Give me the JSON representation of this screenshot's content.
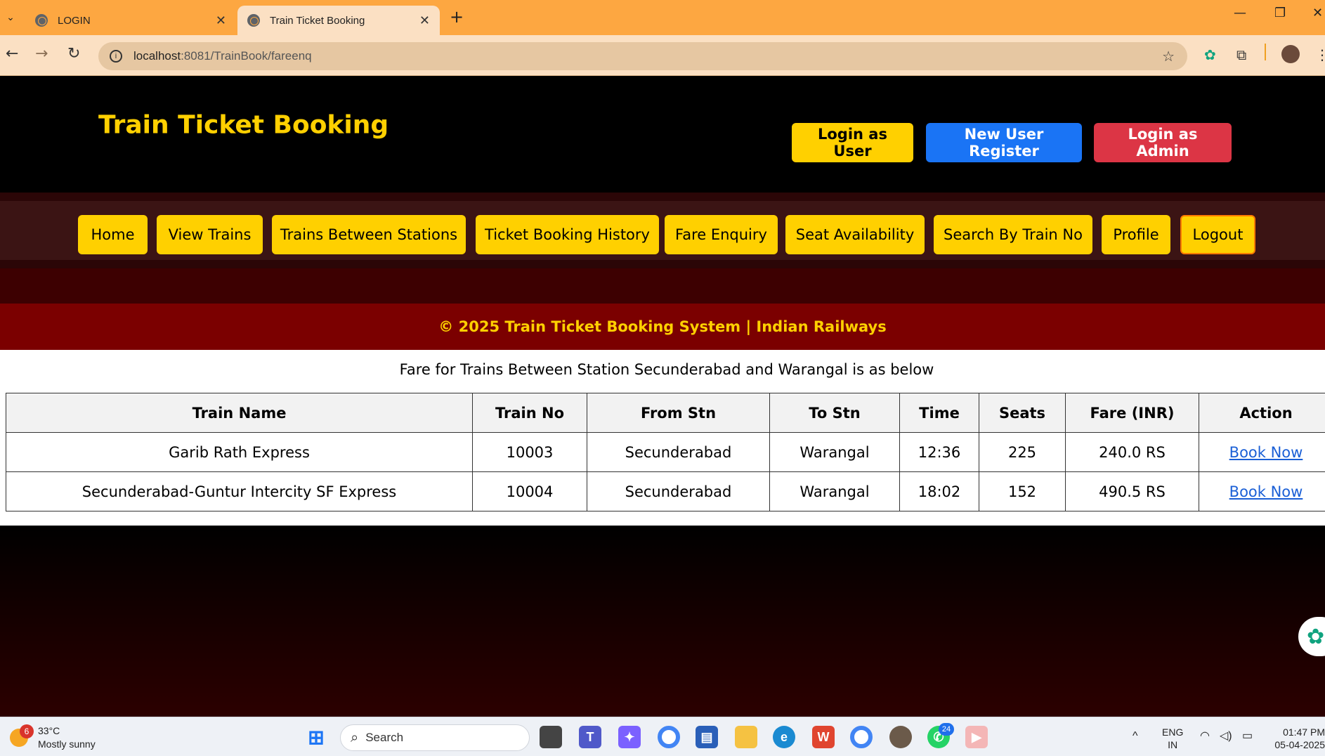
{
  "browser": {
    "tabs": [
      {
        "title": "LOGIN"
      },
      {
        "title": "Train Ticket Booking"
      }
    ],
    "url_host": "localhost",
    "url_path": ":8081/TrainBook/fareenq"
  },
  "header": {
    "site_title": "Train Ticket Booking",
    "buttons": {
      "login_user": "Login as User",
      "register": "New User Register",
      "login_admin": "Login as Admin"
    }
  },
  "nav": {
    "items": [
      {
        "label": "Home"
      },
      {
        "label": "View Trains"
      },
      {
        "label": "Trains Between Stations"
      },
      {
        "label": "Ticket Booking History"
      },
      {
        "label": "Fare Enquiry"
      },
      {
        "label": "Seat Availability"
      },
      {
        "label": "Search By Train No"
      },
      {
        "label": "Profile"
      },
      {
        "label": "Logout"
      }
    ]
  },
  "footer": {
    "text": "© 2025 Train Ticket Booking System | Indian Railways"
  },
  "fare": {
    "caption": "Fare for Trains Between Station Secunderabad and Warangal is as below",
    "columns": [
      "Train Name",
      "Train No",
      "From Stn",
      "To Stn",
      "Time",
      "Seats",
      "Fare (INR)",
      "Action"
    ],
    "rows": [
      [
        "Garib Rath Express",
        "10003",
        "Secunderabad",
        "Warangal",
        "12:36",
        "225",
        "240.0 RS",
        "Book Now"
      ],
      [
        "Secunderabad-Guntur Intercity SF Express",
        "10004",
        "Secunderabad",
        "Warangal",
        "18:02",
        "152",
        "490.5 RS",
        "Book Now"
      ]
    ]
  },
  "taskbar": {
    "weather_badge": "6",
    "temperature": "33°C",
    "condition": "Mostly sunny",
    "search_label": "Search",
    "whatsapp_badge": "24",
    "lang_1": "ENG",
    "lang_2": "IN",
    "time": "01:47 PM",
    "date": "05-04-2025"
  }
}
